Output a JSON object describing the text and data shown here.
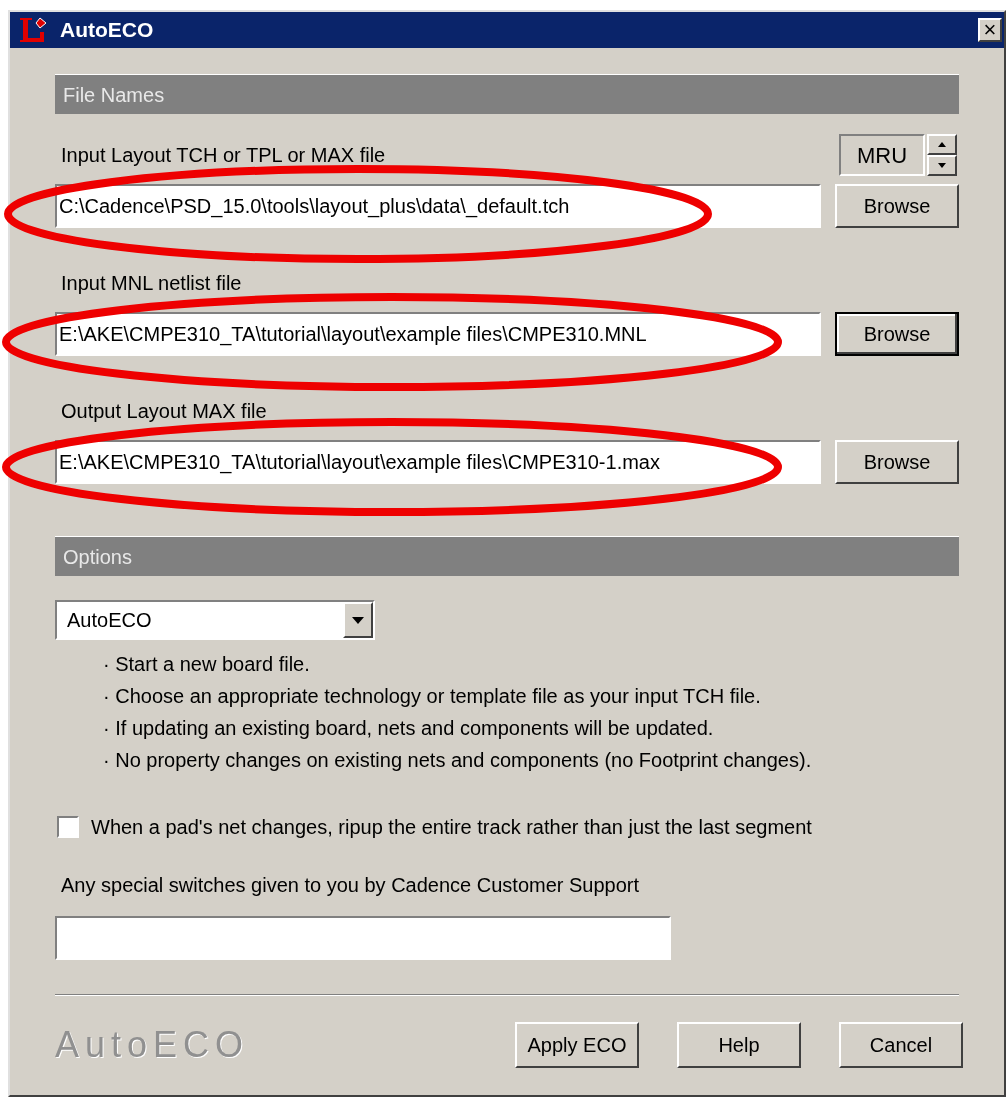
{
  "window": {
    "title": "AutoECO",
    "close": "×"
  },
  "file_names": {
    "header": "File Names",
    "fields": [
      {
        "label": "Input Layout TCH or TPL or MAX file",
        "value": "C:\\Cadence\\PSD_15.0\\tools\\layout_plus\\data\\_default.tch",
        "button": "Browse",
        "focused": false,
        "mru": "MRU"
      },
      {
        "label": "Input MNL netlist file",
        "value": "E:\\AKE\\CMPE310_TA\\tutorial\\layout\\example files\\CMPE310.MNL",
        "button": "Browse",
        "focused": true
      },
      {
        "label": "Output Layout MAX file",
        "value": "E:\\AKE\\CMPE310_TA\\tutorial\\layout\\example files\\CMPE310-1.max",
        "button": "Browse",
        "focused": false
      }
    ]
  },
  "options": {
    "header": "Options",
    "mode": "AutoECO",
    "notes": [
      "· Start a new board file.",
      "· Choose an appropriate technology or template file as your input TCH file.",
      "· If updating an existing board, nets and components will be updated.",
      "· No property changes on existing nets and components (no Footprint changes)."
    ],
    "ripup": {
      "label": "When a pad's net changes, ripup the entire track rather than just the last segment",
      "checked": false
    },
    "switches_label": "Any special switches given to you by Cadence Customer Support"
  },
  "footer": {
    "logo": "AutoECO",
    "buttons": [
      "Apply ECO",
      "Help",
      "Cancel"
    ]
  }
}
